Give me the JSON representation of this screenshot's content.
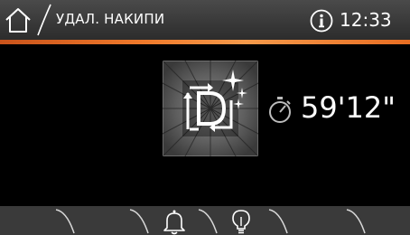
{
  "header": {
    "title": "УДАЛ. НАКИПИ",
    "time": "12:33",
    "accent_color": "#f07a2b"
  },
  "program": {
    "icon": "descaling-program-icon",
    "timer": "59'12\""
  },
  "footer": {
    "icons": [
      "bell-icon",
      "light-bulb-icon"
    ]
  }
}
